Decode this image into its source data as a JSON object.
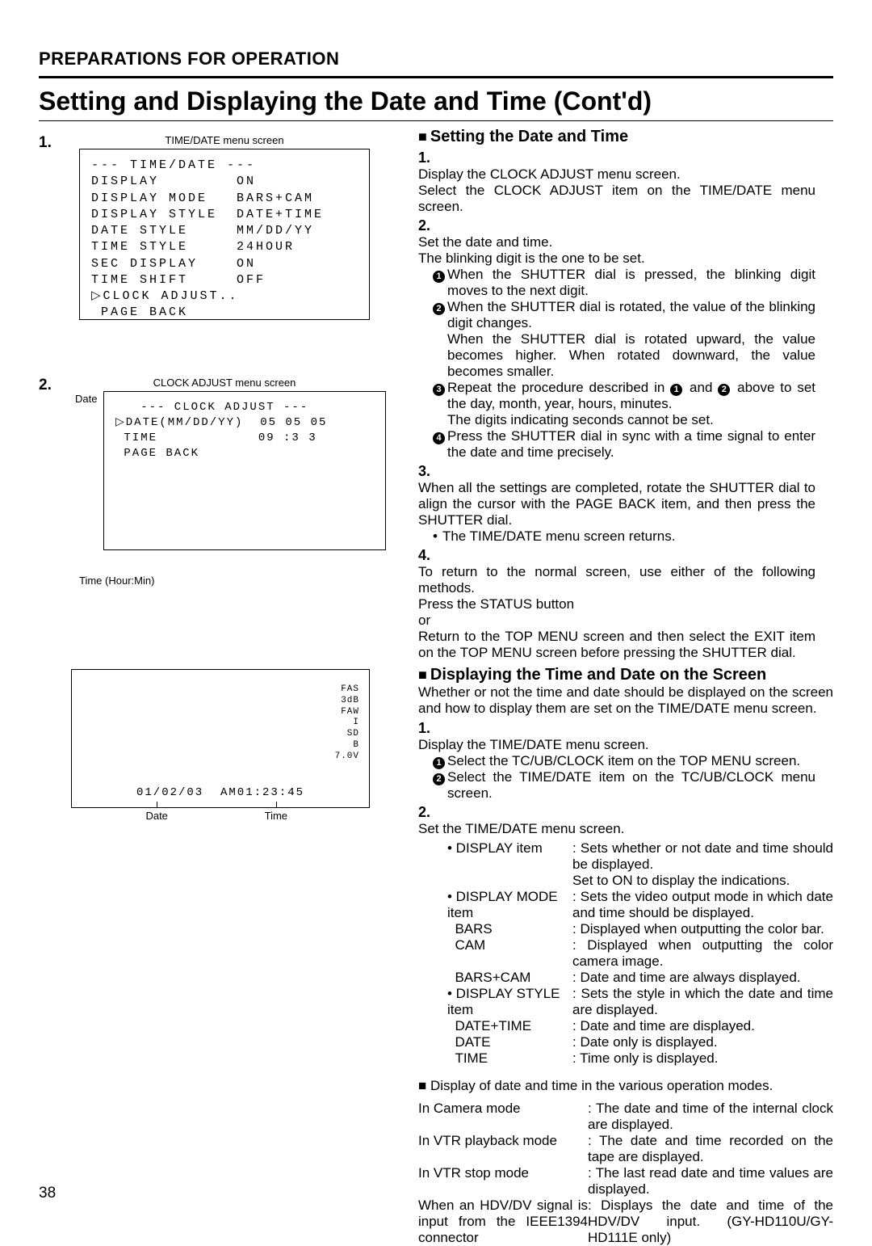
{
  "breadcrumb": "PREPARATIONS FOR OPERATION",
  "title": "Setting and Displaying the Date and Time (Cont'd)",
  "page_number": "38",
  "left": {
    "step1_num": "1.",
    "step2_num": "2.",
    "menu1_caption": "TIME/DATE menu screen",
    "menu1_lines": [
      "--- TIME/DATE ---",
      "DISPLAY        ON",
      "DISPLAY MODE   BARS+CAM",
      "DISPLAY STYLE  DATE+TIME",
      "DATE STYLE     MM/DD/YY",
      "TIME STYLE     24HOUR",
      "SEC DISPLAY    ON",
      "TIME SHIFT     OFF",
      "▷CLOCK ADJUST..",
      " PAGE BACK"
    ],
    "menu2_caption": "CLOCK ADJUST menu screen",
    "menu2_date_label": "Date",
    "menu2_lines": [
      "   --- CLOCK ADJUST ---",
      "▷DATE(MM/DD/YY)  05 05 05",
      " TIME            09 :3 3",
      " PAGE BACK"
    ],
    "menu2_time_label": "Time (Hour:Min)",
    "osd_right": [
      "FAS",
      "3dB",
      "FAW",
      "I",
      "SD",
      "B",
      "7.0V"
    ],
    "osd_bottom": "01/02/03  AM01:23:45",
    "osd_date_label": "Date",
    "osd_time_label": "Time"
  },
  "right": {
    "set_heading": "Setting the Date and Time",
    "s1_num": "1.",
    "s1_a": "Display the CLOCK ADJUST menu screen.",
    "s1_b": "Select the CLOCK ADJUST item on the TIME/DATE menu screen.",
    "s2_num": "2.",
    "s2_a": "Set the date and time.",
    "s2_b": "The blinking digit is the one to be set.",
    "s2_c1": "When the SHUTTER dial is pressed, the blinking digit moves to the next digit.",
    "s2_c2a": "When the SHUTTER dial is rotated, the value of the blinking digit changes.",
    "s2_c2b": "When the SHUTTER dial is rotated upward, the value becomes higher. When rotated downward, the value becomes smaller.",
    "s2_c3a": "Repeat the procedure described in ",
    "s2_c3b": " and ",
    "s2_c3c": " above to set the day, month, year, hours, minutes.",
    "s2_c3d": "The digits indicating seconds cannot be set.",
    "s2_c4": "Press the SHUTTER dial in sync with a time signal to enter the date and time precisely.",
    "s3_num": "3.",
    "s3_a": "When all the settings are completed, rotate the SHUTTER dial to align the cursor with the PAGE BACK item, and then press the SHUTTER dial.",
    "s3_b": "The TIME/DATE menu screen returns.",
    "s4_num": "4.",
    "s4_a": "To return to the normal screen, use either of the following methods.",
    "s4_b": "Press the STATUS button",
    "s4_c": "or",
    "s4_d": "Return to the TOP MENU screen and then select the EXIT item on the TOP MENU screen before pressing the SHUTTER dial.",
    "disp_heading": "Displaying the Time and Date on the Screen",
    "disp_intro": "Whether or not the time and date should be displayed on the screen and how to display them are set on the TIME/DATE menu screen.",
    "d1_num": "1.",
    "d1_a": "Display the TIME/DATE menu screen.",
    "d1_c1": "Select the TC/UB/CLOCK item on the TOP MENU screen.",
    "d1_c2": "Select the TIME/DATE item on the TC/UB/CLOCK menu screen.",
    "d2_num": "2.",
    "d2_a": "Set the TIME/DATE menu screen.",
    "items": [
      {
        "bul": "•",
        "k": "DISPLAY item",
        "d": "Sets whether or not date and time should be displayed.\nSet to ON to display the indications."
      },
      {
        "bul": "•",
        "k": "DISPLAY MODE item",
        "d": "Sets the video output mode in which date and time should be displayed."
      },
      {
        "bul": "",
        "k": "BARS",
        "d": "Displayed when outputting the color bar."
      },
      {
        "bul": "",
        "k": "CAM",
        "d": "Displayed when outputting the color camera image."
      },
      {
        "bul": "",
        "k": "BARS+CAM",
        "d": "Date and time are always displayed."
      },
      {
        "bul": "•",
        "k": "DISPLAY STYLE item",
        "d": "Sets the style in which the date and time are displayed."
      },
      {
        "bul": "",
        "k": "DATE+TIME",
        "d": "Date and time are displayed."
      },
      {
        "bul": "",
        "k": "DATE",
        "d": "Date only is displayed."
      },
      {
        "bul": "",
        "k": "TIME",
        "d": "Time only is displayed."
      }
    ],
    "modes_head": "Display of date and time in the various operation modes.",
    "modes": [
      {
        "k": "In Camera mode",
        "d": "The date and time of the internal clock are displayed."
      },
      {
        "k": "In VTR playback mode",
        "d": "The date and time recorded on the tape are displayed."
      },
      {
        "k": "In VTR stop mode",
        "d": "The last read date and time values are displayed."
      },
      {
        "k": "When an HDV/DV signal is input from the IEEE1394 connector",
        "d": "Displays the date and time of the HDV/DV input. (GY-HD110U/GY-HD111E only)"
      }
    ]
  }
}
